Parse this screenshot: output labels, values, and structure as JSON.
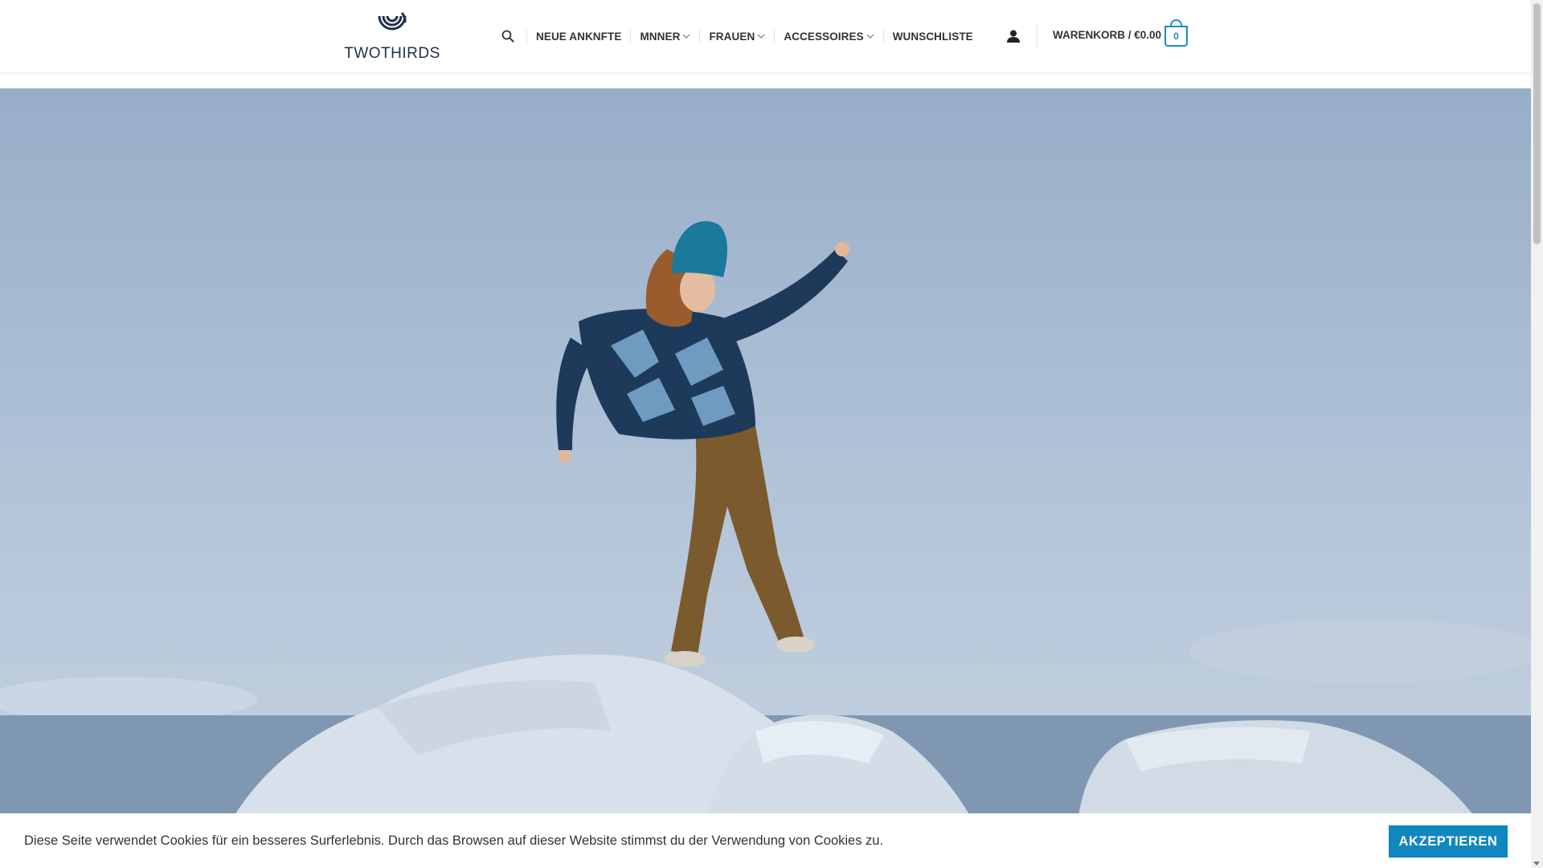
{
  "brand": {
    "name": "TWOTHIRDS"
  },
  "header": {
    "nav": [
      {
        "label": "NEUE ANKNFTE",
        "has_dropdown": false
      },
      {
        "label": "MNNER",
        "has_dropdown": true
      },
      {
        "label": "FRAUEN",
        "has_dropdown": true
      },
      {
        "label": "ACCESSOIRES",
        "has_dropdown": true
      },
      {
        "label": "WUNSCHLISTE",
        "has_dropdown": false
      }
    ],
    "cart": {
      "label": "WARENKORB / €0.00",
      "count": "0"
    },
    "icons": [
      "search-icon",
      "account-icon",
      "cart-icon",
      "chevron-down-icon"
    ]
  },
  "cookie": {
    "text": "Diese Seite verwendet Cookies für ein besseres Surferlebnis. Durch das Browsen auf dieser Website stimmst du der Verwendung von Cookies zu.",
    "button": "AKZEPTIEREN"
  },
  "colors": {
    "accent": "#1187bf",
    "text": "#333333",
    "logo": "#1f2f4a"
  }
}
